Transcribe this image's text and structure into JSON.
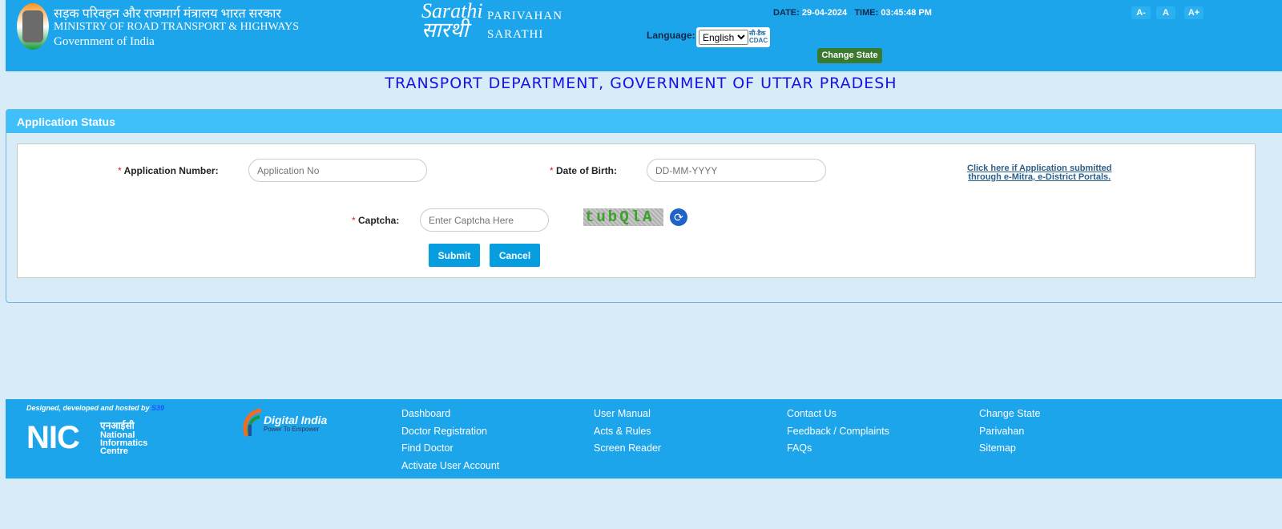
{
  "header": {
    "hindi_title": "सड़क परिवहन और राजमार्ग मंत्रालय भारत सरकार",
    "ministry": "MINISTRY OF ROAD TRANSPORT & HIGHWAYS",
    "government": "Government of India",
    "logo_text_1": "Sarathi",
    "logo_text_2": "सारथी",
    "parivahan": "PARIVAHAN",
    "sarathi": "SARATHI",
    "date_label": "DATE:",
    "date": "29-04-2024",
    "time_label": "TIME:",
    "time": "03:45:48 PM",
    "font_small": "A-",
    "font_normal": "A",
    "font_large": "A+",
    "language_label": "Language:",
    "language_selected": "English",
    "cdac": "सी-डैक CDAC",
    "change_state": "Change State"
  },
  "department_title": "TRANSPORT DEPARTMENT, GOVERNMENT OF UTTAR PRADESH",
  "form": {
    "title": "Application Status",
    "required_mark": "*",
    "app_no_label": "Application Number:",
    "app_no_placeholder": "Application No",
    "dob_label": "Date of Birth:",
    "dob_placeholder": "DD-MM-YYYY",
    "emitra_link_1": "Click here if Application submitted",
    "emitra_link_2": "through e-Mitra, e-District Portals.",
    "captcha_label": "Captcha:",
    "captcha_placeholder": "Enter Captcha Here",
    "captcha_text": "tubQlA",
    "submit": "Submit",
    "cancel": "Cancel"
  },
  "footer": {
    "designed_by": "Designed, developed and hosted by",
    "designed_by_link": "S39",
    "nic": "NIC",
    "nic_hindi": "एनआईसी",
    "nic_line1": "National",
    "nic_line2": "Informatics",
    "nic_line3": "Centre",
    "digital_india": "Digital India",
    "digital_india_tag": "Power To Empower",
    "columns": [
      [
        "Dashboard",
        "Doctor Registration",
        "Find Doctor",
        "Activate User Account"
      ],
      [
        "User Manual",
        "Acts & Rules",
        "Screen Reader"
      ],
      [
        "Contact Us",
        "Feedback / Complaints",
        "FAQs"
      ],
      [
        "Change State",
        "Parivahan",
        "Sitemap"
      ]
    ]
  },
  "colors": {
    "header": "#1da5ec",
    "panel_head": "#3fc0fb",
    "title": "#1414e6",
    "change_state": "#3b7a2e",
    "button": "#079ee0"
  }
}
